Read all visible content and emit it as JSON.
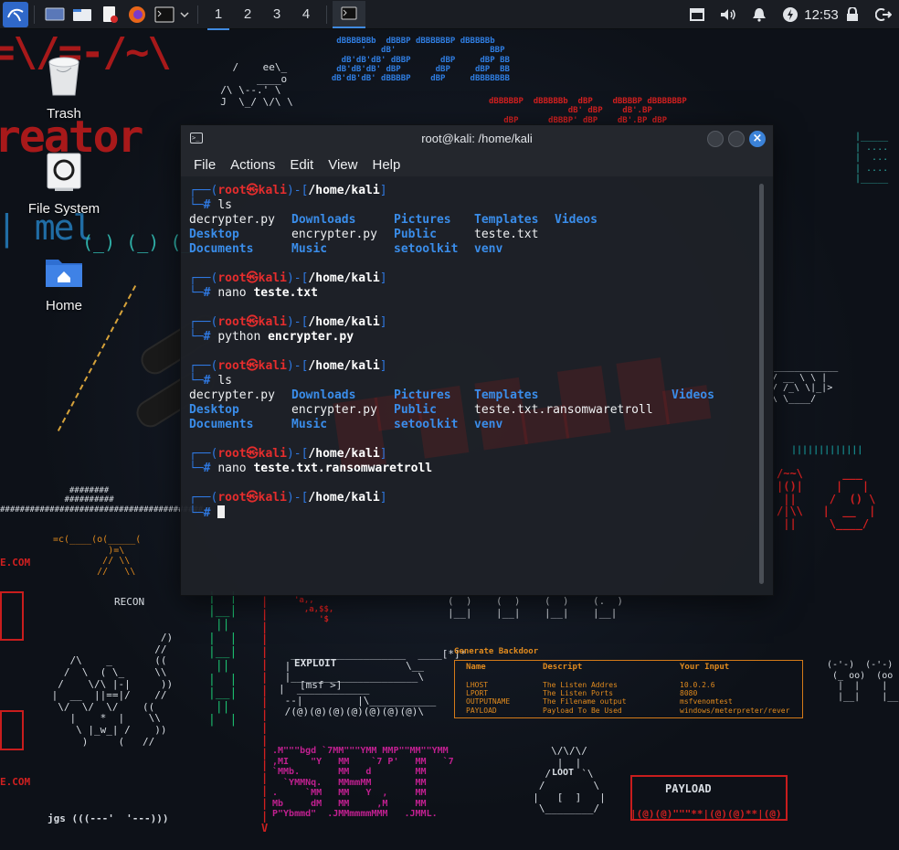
{
  "panel": {
    "workspaces": [
      "1",
      "2",
      "3",
      "4"
    ],
    "active_workspace": "1",
    "clock": "12:53",
    "icons": [
      "kali-menu-icon",
      "desktop-icon",
      "file-manager-icon",
      "text-editor-icon",
      "firefox-icon",
      "terminal-icon",
      "chevron-down-icon"
    ],
    "tray_icons": [
      "screenshot-icon",
      "volume-icon",
      "notification-bell-icon",
      "power-manager-icon",
      "lock-icon",
      "logout-icon"
    ]
  },
  "desktop": {
    "icons": [
      {
        "label": "Trash",
        "icon": "trash-icon"
      },
      {
        "label": "File System",
        "icon": "drive-icon"
      },
      {
        "label": "Home",
        "icon": "home-folder-icon"
      }
    ]
  },
  "wallpaper": {
    "recon": "RECON",
    "exploit": "EXPLOIT",
    "msf": "[msf >]",
    "gen_backdoor": "Generate Backdoor",
    "backdoor_table": {
      "headers": [
        "Name",
        "Descript",
        "Your Input"
      ],
      "rows": [
        [
          "LHOST",
          "The Listen Addres",
          "10.0.2.6"
        ],
        [
          "LPORT",
          "The Listen Ports",
          "8080"
        ],
        [
          "OUTPUTNAME",
          "The Filename output",
          "msfvenomtest"
        ],
        [
          "PAYLOAD",
          "Payload To Be Used",
          "windows/meterpreter/rever"
        ]
      ]
    },
    "loot": "LOOT",
    "payload": "PAYLOAD",
    "jgs": "jgs",
    "com1": "E.COM",
    "com2": "E.COM"
  },
  "terminal": {
    "title": "root@kali: /home/kali",
    "menu": [
      "File",
      "Actions",
      "Edit",
      "View",
      "Help"
    ],
    "prompt": {
      "user": "root",
      "at": "㉿",
      "host": "kali",
      "path": "/home/kali",
      "hash": "#"
    },
    "blocks": [
      {
        "cmd": "ls",
        "arg": ""
      },
      {
        "cmd": "nano",
        "arg": "teste.txt"
      },
      {
        "cmd": "python",
        "arg": "encrypter.py"
      },
      {
        "cmd": "ls",
        "arg": ""
      },
      {
        "cmd": "nano",
        "arg": "teste.txt.ransomwaretroll"
      },
      {
        "cmd": "",
        "arg": ""
      }
    ],
    "ls1": [
      [
        "decrypter.py",
        "Downloads",
        "Pictures",
        "Templates",
        "Videos"
      ],
      [
        "Desktop",
        "encrypter.py",
        "Public",
        "teste.txt",
        ""
      ],
      [
        "Documents",
        "Music",
        "setoolkit",
        "venv",
        ""
      ]
    ],
    "ls2": [
      [
        "decrypter.py",
        "Downloads",
        "Pictures",
        "Templates",
        "Videos"
      ],
      [
        "Desktop",
        "encrypter.py",
        "Public",
        "teste.txt.ransomwaretroll",
        ""
      ],
      [
        "Documents",
        "Music",
        "setoolkit",
        "venv",
        ""
      ]
    ]
  }
}
